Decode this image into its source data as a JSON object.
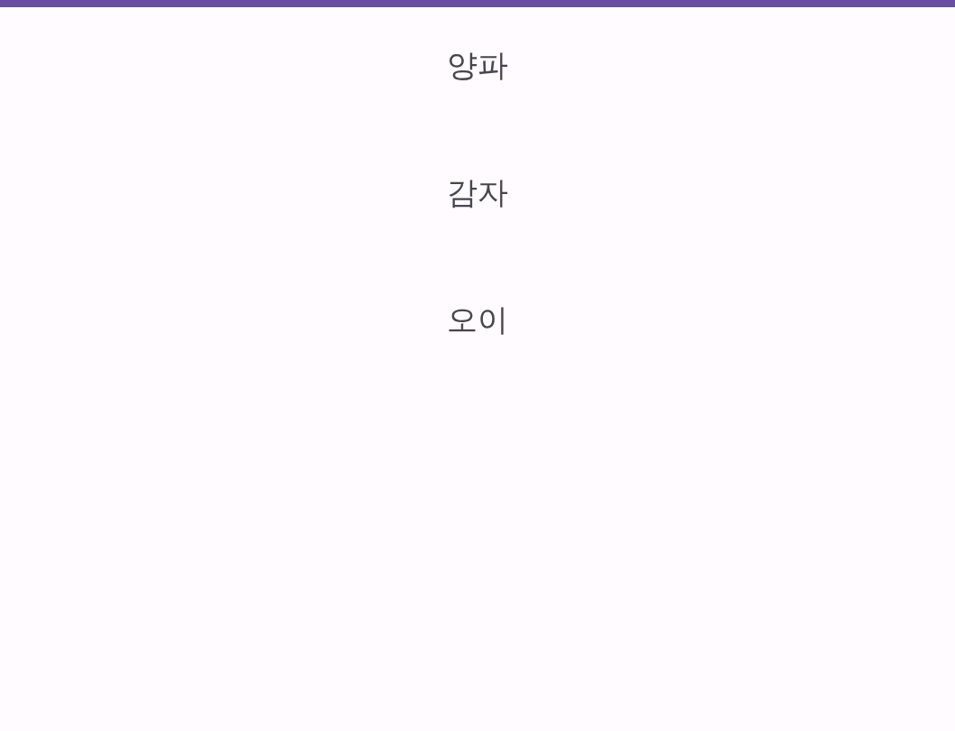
{
  "items": [
    {
      "label": "양파"
    },
    {
      "label": "감자"
    },
    {
      "label": "오이"
    }
  ]
}
